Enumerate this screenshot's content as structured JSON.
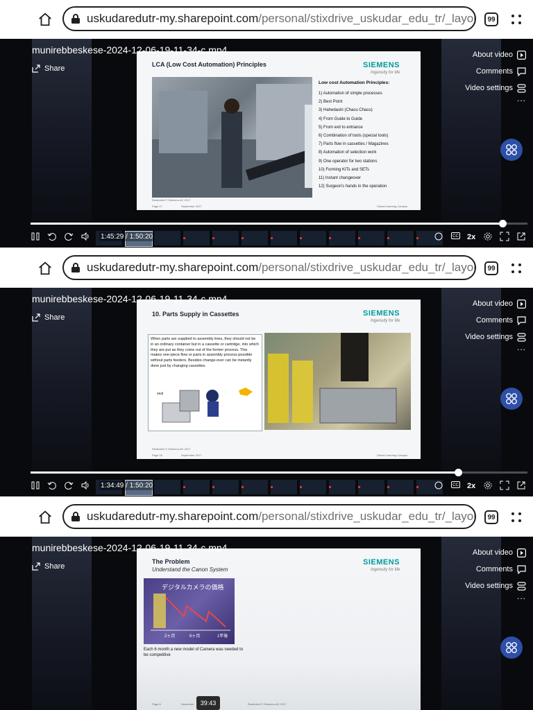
{
  "browser": {
    "url_host": "uskudaredutr-my.sharepoint.com",
    "url_path": "/personal/stixdrive_uskudar_edu_tr/_layouts/",
    "tab_count": "99"
  },
  "player": {
    "file_title": "munirebbeskese-2024-12-06-19-11-34-c.mp4",
    "share_label": "Share",
    "menu": {
      "about": "About video",
      "comments": "Comments",
      "settings": "Video settings",
      "more": "..."
    },
    "speed": "2x",
    "cc_label": "CC",
    "accent_color": "#2d4fa8"
  },
  "frames": [
    {
      "time": "1:45:29 / 1:50:20",
      "progress_fraction": 0.95,
      "slide": {
        "title": "LCA (Low Cost Automation) Principles",
        "brand": "SIEMENS",
        "brand_tag": "Ingenuity for life",
        "principles_heading": "Low cost Automation Principles:",
        "principles": [
          "1)  Automation of simple processes",
          "2)  Best Point",
          "3)  Hahedashi (Chacu Chacu)",
          "4)  From Guide to Guide",
          "5)  From exit to entrance",
          "6)  Combination of tools (special tools)",
          "7)  Parts flow in cassettes / Magazines",
          "8)  Automation of selection work",
          "9)  One operator for two stations",
          "10)  Forming KITs and SETs",
          "11)  Instant changeover",
          "12)  Surgeon's hands in the operation"
        ],
        "foot_left": "Restricted © Siemens AG 2017",
        "foot_page": "Page 17",
        "foot_date": "September 2017",
        "foot_right": "Global Learning Campus"
      }
    },
    {
      "time": "1:34:49 / 1:50:20",
      "progress_fraction": 0.86,
      "slide": {
        "title": "10. Parts Supply in Cassettes",
        "brand": "SIEMENS",
        "brand_tag": "Ingenuity for life",
        "body": "When parts are supplied to assembly lines, they should not be in an ordinary container but in a cassette or cartridge, into which they are put as they come out of the former process. This makes one-piece flow or parts in assembly process possible without parts feeders. Besides change-over can be instantly done just by changing cassettes.",
        "foot_left": "Restricted © Siemens AG 2017",
        "foot_page": "Page 16",
        "foot_date": "September 2017",
        "foot_right": "Global Learning Campus"
      }
    },
    {
      "hover_time": "39:43",
      "slide": {
        "title": "The Problem",
        "subtitle": "Understand the Canon System",
        "brand": "SIEMENS",
        "brand_tag": "Ingenuity for life",
        "caption": "Each 6 month a new model of Camera was needed to be competitive",
        "chart_heading": "デジタルカメラの価格",
        "chart_labels": [
          "2ヶ月",
          "6ヶ月",
          "1年後"
        ],
        "foot_left": "Page 6",
        "foot_date": "December",
        "foot_right": "Restricted © Siemens AG 2017"
      }
    }
  ]
}
